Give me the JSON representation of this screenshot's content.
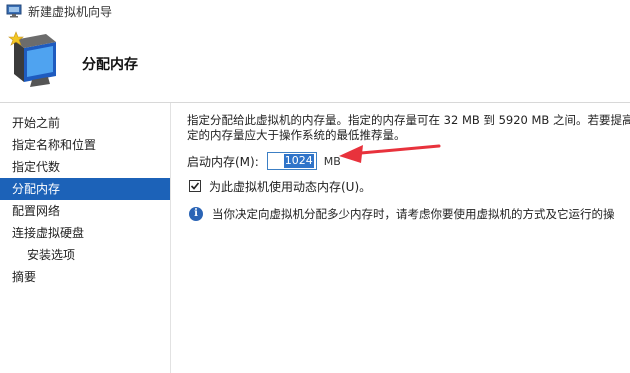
{
  "window": {
    "title": "新建虚拟机向导"
  },
  "header": {
    "page_title": "分配内存"
  },
  "sidebar": {
    "items": [
      {
        "label": "开始之前",
        "active": false,
        "sub": false
      },
      {
        "label": "指定名称和位置",
        "active": false,
        "sub": false
      },
      {
        "label": "指定代数",
        "active": false,
        "sub": false
      },
      {
        "label": "分配内存",
        "active": true,
        "sub": false
      },
      {
        "label": "配置网络",
        "active": false,
        "sub": false
      },
      {
        "label": "连接虚拟硬盘",
        "active": false,
        "sub": false
      },
      {
        "label": "安装选项",
        "active": false,
        "sub": true
      },
      {
        "label": "摘要",
        "active": false,
        "sub": false
      }
    ]
  },
  "main": {
    "description_line1": "指定分配给此虚拟机的内存量。指定的内存量可在 32 MB 到 5920 MB 之间。若要提高",
    "description_line2": "定的内存量应大于操作系统的最低推荐量。",
    "startup_memory": {
      "label": "启动内存(M):",
      "value": "1024",
      "unit": "MB"
    },
    "dynamic_memory": {
      "label": "为此虚拟机使用动态内存(U)。",
      "checked": true
    },
    "info_text": "当你决定向虚拟机分配多少内存时，请考虑你要使用虚拟机的方式及它运行的操"
  },
  "colors": {
    "selection": "#1c62b8",
    "arrow": "#e8323c",
    "info": "#2a64b5"
  }
}
